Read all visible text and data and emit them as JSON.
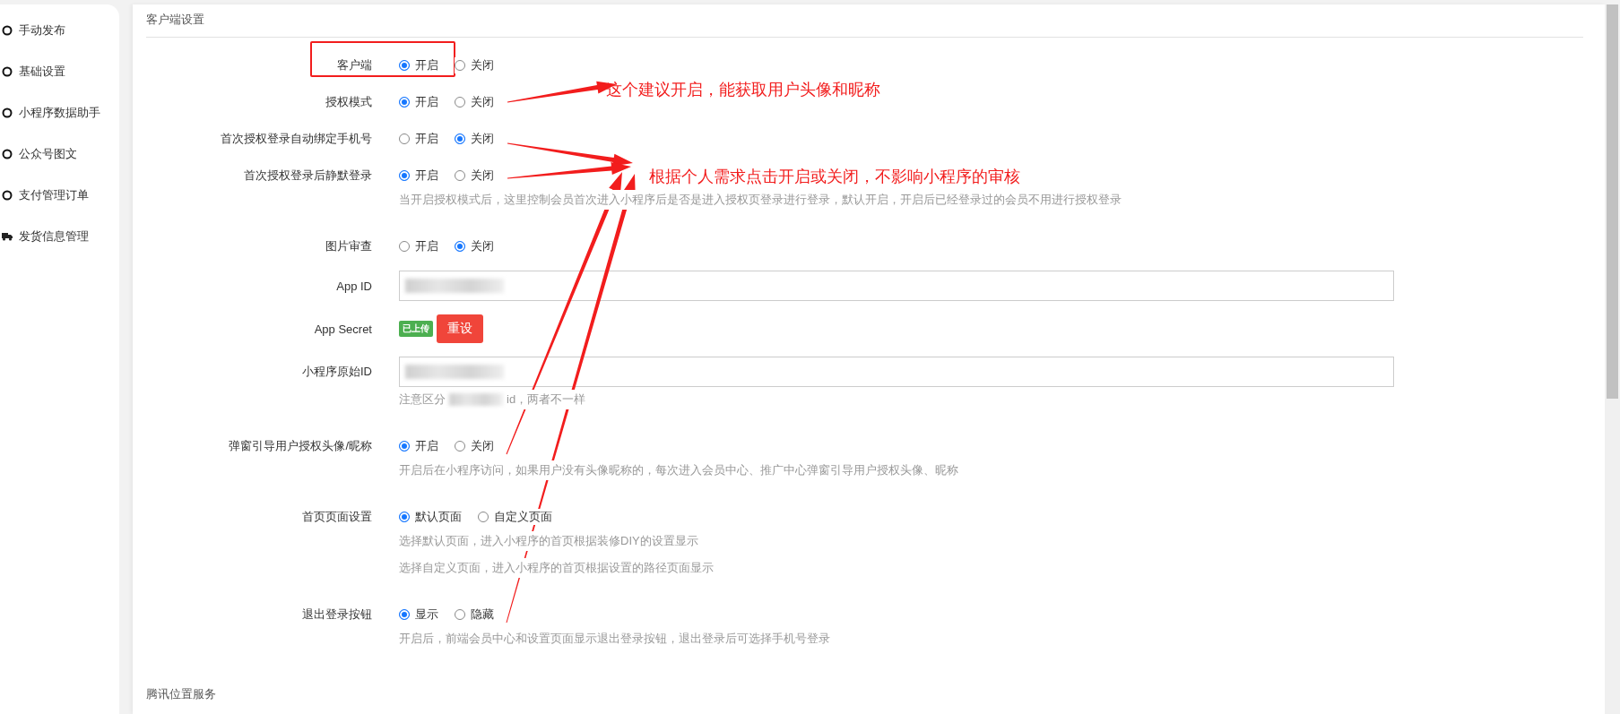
{
  "sidebar": {
    "items": [
      {
        "label": "手动发布",
        "kind": "circle"
      },
      {
        "label": "基础设置",
        "kind": "circle"
      },
      {
        "label": "小程序数据助手",
        "kind": "circle"
      },
      {
        "label": "公众号图文",
        "kind": "circle"
      },
      {
        "label": "支付管理订单",
        "kind": "circle"
      },
      {
        "label": "发货信息管理",
        "kind": "truck"
      }
    ]
  },
  "section_title": "客户端设置",
  "fields": [
    {
      "kind": "radio",
      "label": "客户端",
      "options": [
        {
          "label": "开启",
          "selected": true
        },
        {
          "label": "关闭",
          "selected": false
        }
      ]
    },
    {
      "kind": "radio",
      "label": "授权模式",
      "options": [
        {
          "label": "开启",
          "selected": true
        },
        {
          "label": "关闭",
          "selected": false
        }
      ]
    },
    {
      "kind": "radio",
      "label": "首次授权登录自动绑定手机号",
      "options": [
        {
          "label": "开启",
          "selected": false
        },
        {
          "label": "关闭",
          "selected": true
        }
      ]
    },
    {
      "kind": "radio",
      "label": "首次授权登录后静默登录",
      "options": [
        {
          "label": "开启",
          "selected": true
        },
        {
          "label": "关闭",
          "selected": false
        }
      ],
      "help": [
        [
          "当开启授权模式后，这里控制会员首次进入小程序后是否是进入授权页登录进行登录，默认开启，开启后已经登录过的会员不用进行授权登录"
        ]
      ]
    },
    {
      "kind": "radio",
      "label": "图片审查",
      "options": [
        {
          "label": "开启",
          "selected": false
        },
        {
          "label": "关闭",
          "selected": true
        }
      ]
    },
    {
      "kind": "input",
      "label": "App ID",
      "redacted": true
    },
    {
      "kind": "secret",
      "label": "App Secret",
      "badge": "已上传",
      "button": "重设"
    },
    {
      "kind": "input",
      "label": "小程序原始ID",
      "redacted": true,
      "help": [
        [
          "注意区分",
          "id，两者不一样"
        ]
      ]
    },
    {
      "kind": "radio",
      "label": "弹窗引导用户授权头像/昵称",
      "options": [
        {
          "label": "开启",
          "selected": true
        },
        {
          "label": "关闭",
          "selected": false
        }
      ],
      "help": [
        [
          "开启后在小程序访问，如果用户没有头像昵称的，每次进入会员中心、推广中心弹窗引导用户授权头像、昵称"
        ]
      ]
    },
    {
      "kind": "radio",
      "label": "首页页面设置",
      "options": [
        {
          "label": "默认页面",
          "selected": true
        },
        {
          "label": "自定义页面",
          "selected": false
        }
      ],
      "help": [
        [
          "选择默认页面，进入小程序的首页根据装修DIY的设置显示"
        ],
        [
          "选择自定义页面，进入小程序的首页根据设置的路径页面显示"
        ]
      ]
    },
    {
      "kind": "radio",
      "label": "退出登录按钮",
      "options": [
        {
          "label": "显示",
          "selected": true
        },
        {
          "label": "隐藏",
          "selected": false
        }
      ],
      "help": [
        [
          "开启后，前端会员中心和设置页面显示退出登录按钮，退出登录后可选择手机号登录"
        ]
      ]
    }
  ],
  "next_section_title": "腾讯位置服务",
  "annotations": {
    "highlight_first_field": true,
    "callouts": [
      {
        "text": "这个建议开启，能获取用户头像和昵称",
        "kind": "top"
      },
      {
        "text": "根据个人需求点击开启或关闭，不影响小程序的审核",
        "kind": "middle"
      }
    ]
  }
}
